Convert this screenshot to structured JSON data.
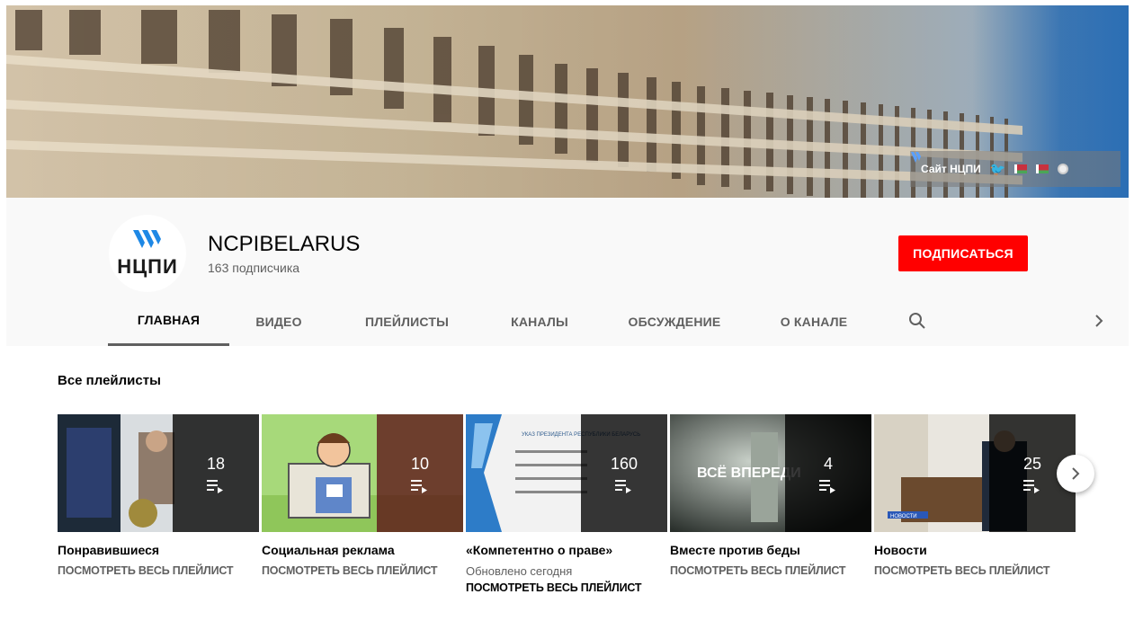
{
  "banner": {
    "site_label": "Сайт НЦПИ"
  },
  "channel": {
    "logo_text": "НЦПИ",
    "name": "NCPIBELARUS",
    "subscribers": "163 подписчика",
    "subscribe_label": "ПОДПИСАТЬСЯ"
  },
  "tabs": [
    {
      "label": "ГЛАВНАЯ",
      "active": true
    },
    {
      "label": "ВИДЕО"
    },
    {
      "label": "ПЛЕЙЛИСТЫ"
    },
    {
      "label": "КАНАЛЫ"
    },
    {
      "label": "ОБСУЖДЕНИЕ"
    },
    {
      "label": "О КАНАЛЕ"
    }
  ],
  "section_title": "Все плейлисты",
  "playlists": [
    {
      "title": "Понравившиеся",
      "count": "18",
      "link": "ПОСМОТРЕТЬ ВЕСЬ ПЛЕЙЛИСТ"
    },
    {
      "title": "Социальная реклама",
      "count": "10",
      "link": "ПОСМОТРЕТЬ ВЕСЬ ПЛЕЙЛИСТ"
    },
    {
      "title": "«Компетентно о праве»",
      "count": "160",
      "updated": "Обновлено сегодня",
      "link": "ПОСМОТРЕТЬ ВЕСЬ ПЛЕЙЛИСТ"
    },
    {
      "title": "Вместе против беды",
      "count": "4",
      "link": "ПОСМОТРЕТЬ ВЕСЬ ПЛЕЙЛИСТ"
    },
    {
      "title": "Новости",
      "count": "25",
      "link": "ПОСМОТРЕТЬ ВЕСЬ ПЛЕЙЛИСТ"
    }
  ],
  "thumb_texts": {
    "p3_heading": "УКАЗ ПРЕЗИДЕНТА РЕСПУБЛИКИ БЕЛАРУСЬ",
    "p4_text": "ВСЁ ВПЕРЕДИ",
    "p5_caption": "НОВОСТИ"
  },
  "colors": {
    "subscribe": "#ff0000",
    "brand_blue": "#1e88e5",
    "text_secondary": "#606060"
  }
}
